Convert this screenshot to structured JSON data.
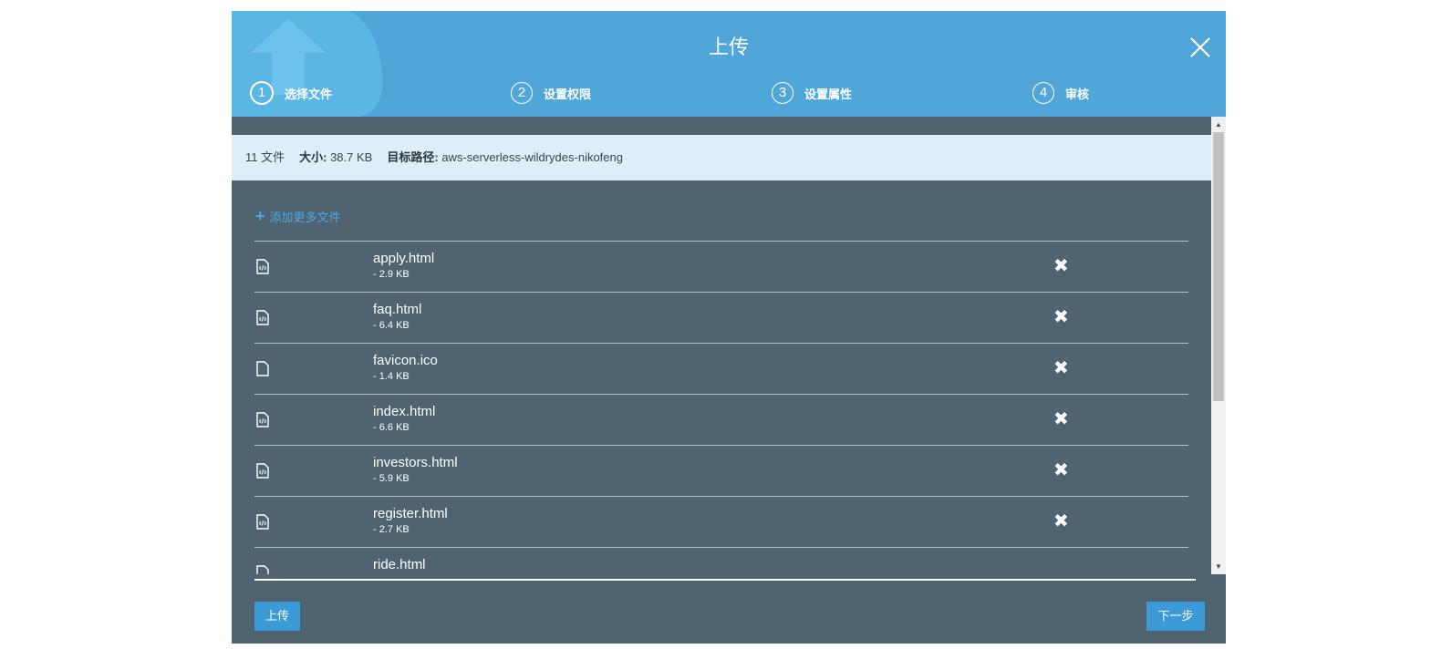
{
  "dialog": {
    "title": "上传",
    "steps": [
      {
        "number": "1",
        "label": "选择文件",
        "active": true
      },
      {
        "number": "2",
        "label": "设置权限",
        "active": false
      },
      {
        "number": "3",
        "label": "设置属性",
        "active": false
      },
      {
        "number": "4",
        "label": "审核",
        "active": false
      }
    ]
  },
  "summary": {
    "file_count": "11 文件",
    "size_label": "大小:",
    "size_value": "38.7 KB",
    "target_label": "目标路径:",
    "target_value": "aws-serverless-wildrydes-nikofeng"
  },
  "add_more_label": "添加更多文件",
  "files": [
    {
      "name": "apply.html",
      "size": "- 2.9 KB",
      "icon": "html-file-icon"
    },
    {
      "name": "faq.html",
      "size": "- 6.4 KB",
      "icon": "html-file-icon"
    },
    {
      "name": "favicon.ico",
      "size": "- 1.4 KB",
      "icon": "file-icon"
    },
    {
      "name": "index.html",
      "size": "- 6.6 KB",
      "icon": "html-file-icon"
    },
    {
      "name": "investors.html",
      "size": "- 5.9 KB",
      "icon": "html-file-icon"
    },
    {
      "name": "register.html",
      "size": "- 2.7 KB",
      "icon": "html-file-icon"
    },
    {
      "name": "ride.html",
      "size": "",
      "icon": "html-file-icon"
    }
  ],
  "footer": {
    "upload_label": "上传",
    "next_label": "下一步"
  },
  "colors": {
    "header": "#50a6d9",
    "body": "#4f6470",
    "infobar": "#ddeef8",
    "accent": "#3c9ad6",
    "link": "#4aa8e0"
  }
}
